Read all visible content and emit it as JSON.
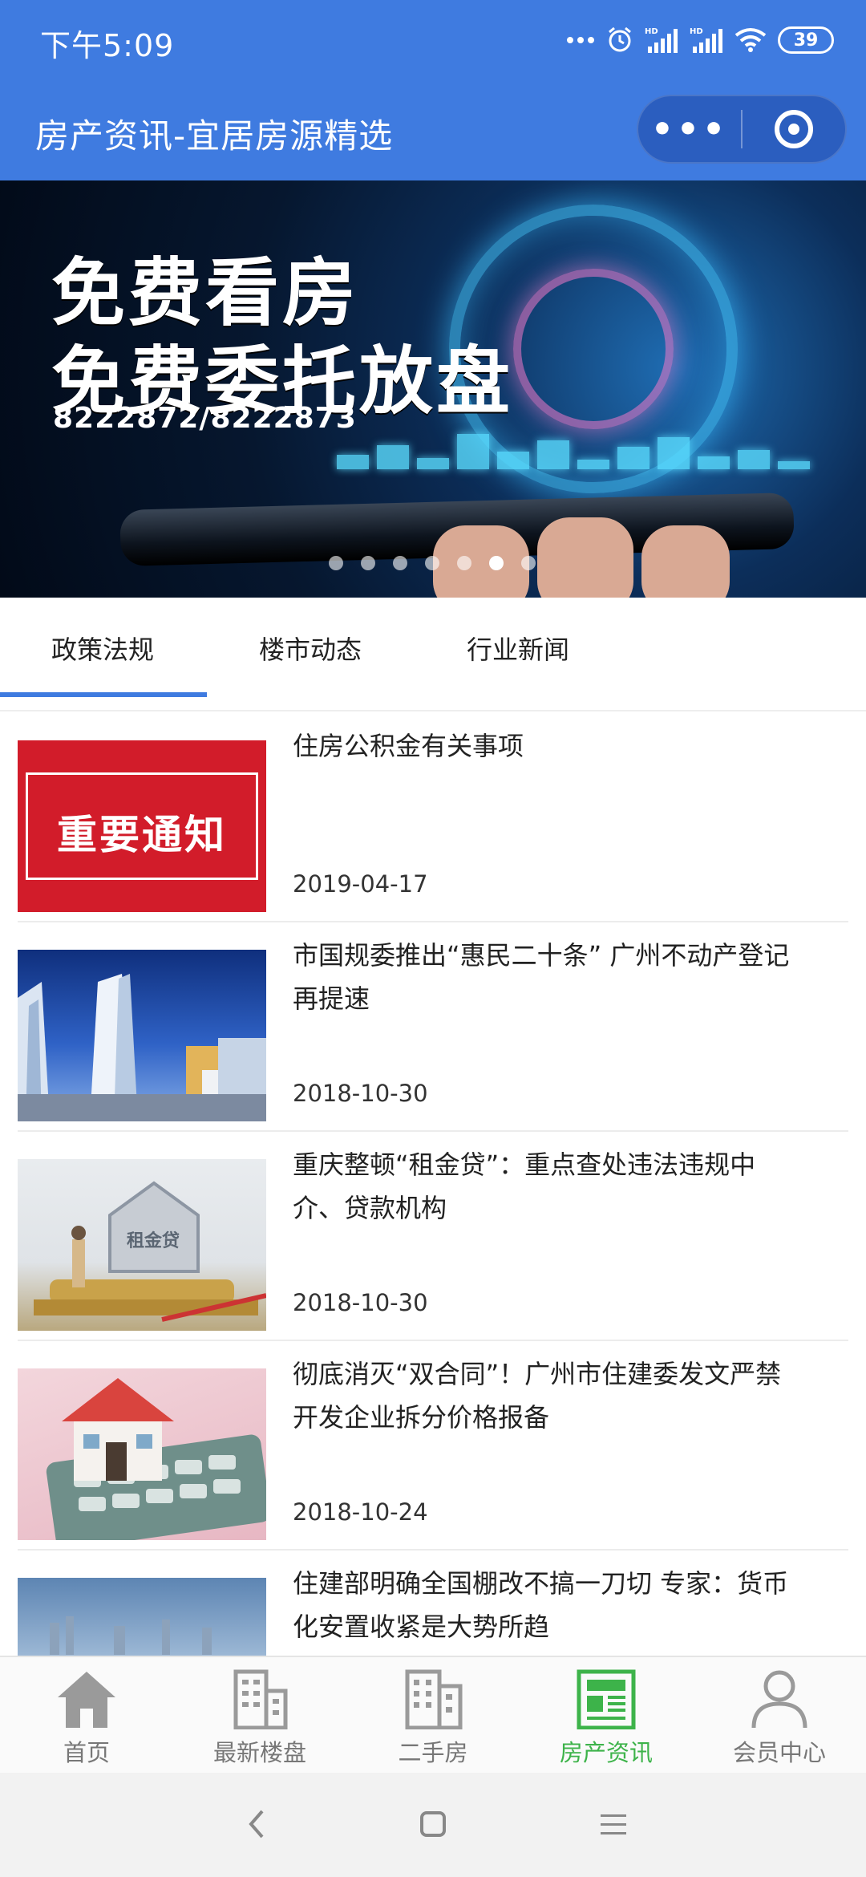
{
  "status_bar": {
    "time": "下午5:09",
    "battery": "39",
    "icons": [
      "more-dots-icon",
      "alarm-icon",
      "signal-hd-icon",
      "signal-hd-icon",
      "wifi-icon",
      "battery-icon"
    ]
  },
  "header": {
    "title": "房产资讯-宜居房源精选",
    "capsule": {
      "more_label": "•••",
      "more_icon": "more-dots-icon",
      "close_icon": "target-circle-icon"
    },
    "background_color": "#3f7be0"
  },
  "banner": {
    "line1": "免费看房",
    "line2": "免费委托放盘",
    "phone": "8222872/8222873",
    "slide_count": 7,
    "active_slide": 5
  },
  "tabs": [
    {
      "label": "政策法规",
      "active": true
    },
    {
      "label": "楼市动态",
      "active": false
    },
    {
      "label": "行业新闻",
      "active": false
    }
  ],
  "news": [
    {
      "title": "住房公积金有关事项",
      "date": "2019-04-17",
      "thumb_text": "重要通知"
    },
    {
      "title": "市国规委推出“惠民二十条” 广州不动产登记再提速",
      "date": "2018-10-30",
      "thumb_text": ""
    },
    {
      "title": "重庆整顿“租金贷”：重点查处违法违规中介、贷款机构",
      "date": "2018-10-30",
      "thumb_text": "租金贷"
    },
    {
      "title": "彻底消灭“双合同”！广州市住建委发文严禁开发企业拆分价格报备",
      "date": "2018-10-24",
      "thumb_text": ""
    },
    {
      "title": "住建部明确全国棚改不搞一刀切 专家：货币化安置收紧是大势所趋",
      "date": "",
      "thumb_text": ""
    }
  ],
  "bottom_nav": [
    {
      "label": "首页",
      "icon": "home-icon",
      "active": false
    },
    {
      "label": "最新楼盘",
      "icon": "building-icon",
      "active": false
    },
    {
      "label": "二手房",
      "icon": "buildings-icon",
      "active": false
    },
    {
      "label": "房产资讯",
      "icon": "newspaper-icon",
      "active": true
    },
    {
      "label": "会员中心",
      "icon": "user-icon",
      "active": false
    }
  ],
  "colors": {
    "accent": "#3f7be0",
    "nav_active": "#3db34a",
    "nav_inactive": "#8a8a8a"
  },
  "system_nav": {
    "icons": [
      "back-icon",
      "home-square-icon",
      "menu-icon"
    ]
  }
}
